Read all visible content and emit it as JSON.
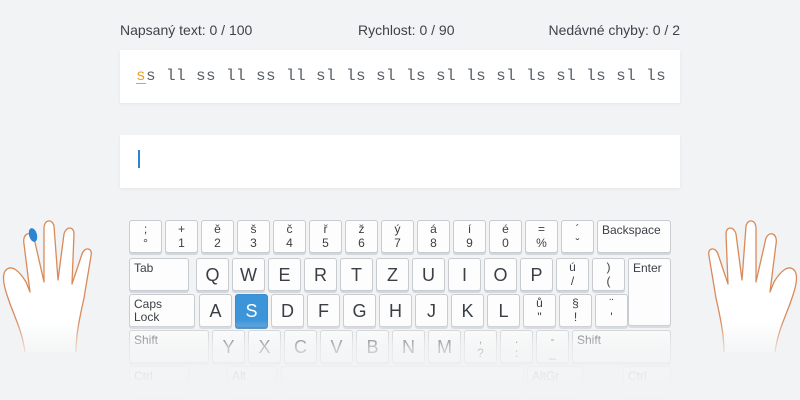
{
  "stats": {
    "typed": "Napsaný text: 0 / 100",
    "speed": "Rychlost: 0 / 90",
    "errors": "Nedávné chyby: 0 / 2"
  },
  "lesson": {
    "current_char": "s",
    "remaining_text": "s ll ss ll ss ll sl ls sl ls sl ls sl ls sl ls sl ls"
  },
  "input": {
    "value": ""
  },
  "colors": {
    "accent": "#3d95d9",
    "cursor_highlight": "#e9a12a",
    "finger": "#2b85d0"
  },
  "keyboard": {
    "row1": [
      {
        "top": ";",
        "bot": "°"
      },
      {
        "top": "+",
        "bot": "1"
      },
      {
        "top": "ě",
        "bot": "2"
      },
      {
        "top": "š",
        "bot": "3"
      },
      {
        "top": "č",
        "bot": "4"
      },
      {
        "top": "ř",
        "bot": "5"
      },
      {
        "top": "ž",
        "bot": "6"
      },
      {
        "top": "ý",
        "bot": "7"
      },
      {
        "top": "á",
        "bot": "8"
      },
      {
        "top": "í",
        "bot": "9"
      },
      {
        "top": "é",
        "bot": "0"
      },
      {
        "top": "=",
        "bot": "%"
      },
      {
        "top": "´",
        "bot": "ˇ"
      }
    ],
    "backspace": "Backspace",
    "tab": "Tab",
    "row2": [
      "Q",
      "W",
      "E",
      "R",
      "T",
      "Z",
      "U",
      "I",
      "O",
      "P"
    ],
    "row2_extra": [
      {
        "top": "ú",
        "bot": "/"
      },
      {
        "top": ")",
        "bot": "("
      }
    ],
    "enter": "Enter",
    "caps": "Caps Lock",
    "row3": [
      "A",
      "S",
      "D",
      "F",
      "G",
      "H",
      "J",
      "K",
      "L"
    ],
    "row3_extra": [
      {
        "top": "ů",
        "bot": "\""
      },
      {
        "top": "§",
        "bot": "!"
      },
      {
        "top": "¨",
        "bot": "'"
      }
    ],
    "active_key": "S",
    "shift_left": "Shift",
    "row4": [
      "Y",
      "X",
      "C",
      "V",
      "B",
      "N",
      "M"
    ],
    "row4_extra": [
      {
        "top": ",",
        "bot": "?"
      },
      {
        "top": ".",
        "bot": ":"
      },
      {
        "top": "-",
        "bot": "_"
      }
    ],
    "shift_right": "Shift",
    "ctrl_left": "Ctrl",
    "alt": "Alt",
    "altgr": "AltGr",
    "ctrl_right": "Ctrl"
  }
}
